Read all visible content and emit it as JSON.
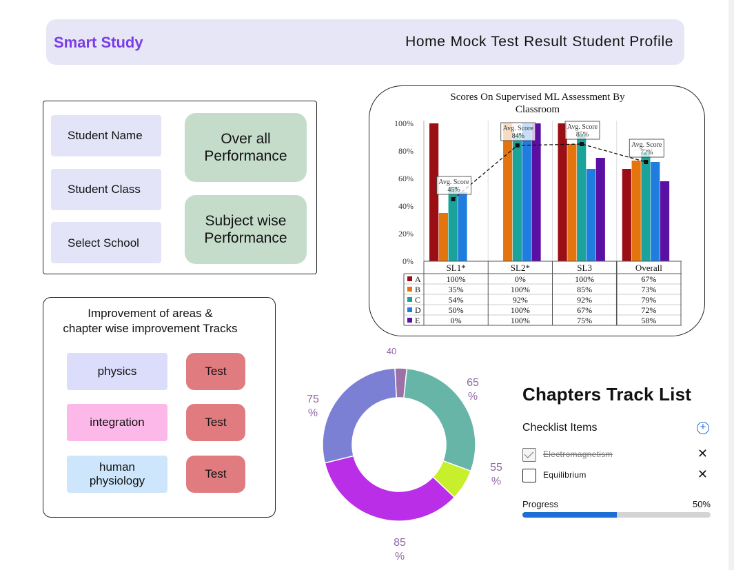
{
  "nav": {
    "brand": "Smart Study",
    "menu": [
      "Home",
      "Mock Test",
      "Result",
      "Student Profile"
    ]
  },
  "student_panel": {
    "fields": [
      "Student Name",
      "Student Class",
      "Select School"
    ],
    "overall_button": "Over all\nPerformance",
    "subject_button": "Subject wise\nPerformance"
  },
  "improvement": {
    "title": "Improvement of areas &\nchapter wise improvement Tracks",
    "subjects": [
      {
        "name": "physics",
        "color": "#dcdcfb",
        "test_label": "Test"
      },
      {
        "name": "integration",
        "color": "#fcb8e8",
        "test_label": "Test"
      },
      {
        "name": "human\nphysiology",
        "color": "#cde6fb",
        "test_label": "Test"
      }
    ]
  },
  "chart_data": [
    {
      "type": "bar",
      "title": "Scores On Supervised ML Assessment By\nClassroom",
      "categories": [
        "SL1*",
        "SL2*",
        "SL3",
        "Overall"
      ],
      "series": [
        {
          "name": "A",
          "color": "#9b0e13",
          "values": [
            100,
            0,
            100,
            67
          ]
        },
        {
          "name": "B",
          "color": "#e4740e",
          "values": [
            35,
            100,
            85,
            73
          ]
        },
        {
          "name": "C",
          "color": "#19a39b",
          "values": [
            54,
            92,
            92,
            79
          ]
        },
        {
          "name": "D",
          "color": "#1f7de0",
          "values": [
            50,
            100,
            67,
            72
          ]
        },
        {
          "name": "E",
          "color": "#5a11a3",
          "values": [
            0,
            100,
            75,
            58
          ]
        }
      ],
      "table_rows": [
        [
          "100%",
          "0%",
          "100%",
          "67%"
        ],
        [
          "35%",
          "100%",
          "85%",
          "73%"
        ],
        [
          "54%",
          "92%",
          "92%",
          "79%"
        ],
        [
          "50%",
          "100%",
          "67%",
          "72%"
        ],
        [
          "0%",
          "100%",
          "75%",
          "58%"
        ]
      ],
      "avg_scores": [
        45,
        84,
        85,
        72
      ],
      "avg_label": "Avg. Score",
      "y_ticks": [
        "0%",
        "20%",
        "40%",
        "60%",
        "80%",
        "100%"
      ],
      "ylim": [
        0,
        100
      ],
      "grid": false
    },
    {
      "type": "pie",
      "labels": [
        "40",
        "65\n%",
        "55\n%",
        "85\n%",
        "75\n%"
      ],
      "values": [
        2.5,
        29,
        6.5,
        34,
        28
      ],
      "colors": [
        "#9c71a8",
        "#66b5a6",
        "#c8ef2b",
        "#b92ee6",
        "#7b80d4"
      ],
      "label_color": "#9068a6"
    }
  ],
  "checklist": {
    "title": "Chapters Track List",
    "subtitle": "Checklist Items",
    "items": [
      {
        "label": "Electromagnetism",
        "checked": true
      },
      {
        "label": "Equilibrium",
        "checked": false
      }
    ],
    "progress_label": "Progress",
    "progress_value": "50%",
    "progress_fraction": 0.5,
    "accent": "#1d6fd6"
  }
}
